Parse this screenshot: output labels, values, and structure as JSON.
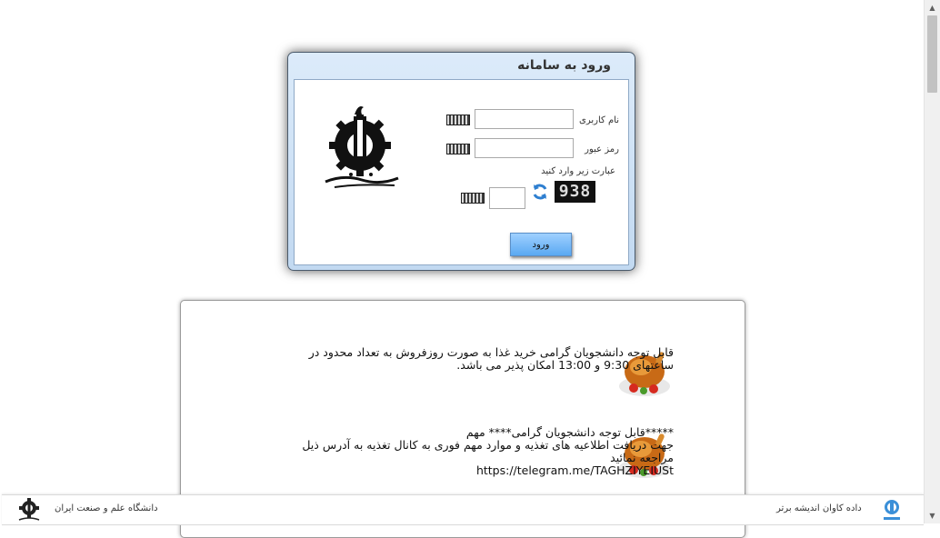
{
  "login": {
    "title": "ورود به سامانه",
    "username_label": "نام کاربری",
    "password_label": "رمز عبور",
    "username_value": "",
    "password_value": "",
    "captcha_prompt": "عبارت زیر وارد کنید",
    "captcha_code": "938",
    "captcha_value": "",
    "submit_label": "ورود"
  },
  "news": [
    {
      "text": "قابل توجه دانشجویان گرامی خرید غذا به صورت روزفروش به تعداد محدود در ساعتهای 9:30 و 13:00 امکان پذیر می باشد."
    },
    {
      "line1": "*****قابل توجه دانشجویان گرامی**** مهم",
      "line2": "جهت دریافت اطلاعیه های تغذیه و موارد مهم فوری به کانال تغذیه به آدرس ذیل مراجعه نمائید",
      "url": "https://telegram.me/TAGHZIYEIUSt"
    }
  ],
  "footer": {
    "university": "دانشگاه علم و صنعت ایران",
    "company": "داده کاوان اندیشه برتر"
  },
  "colors": {
    "accent": "#5aa9f2",
    "window_border": "#4a5a6b"
  }
}
